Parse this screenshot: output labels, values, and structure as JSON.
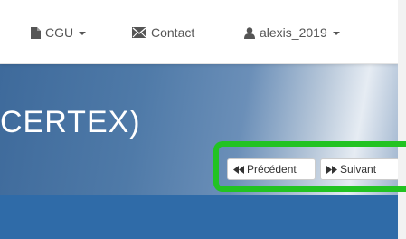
{
  "navbar": {
    "items": [
      {
        "label": "CGU",
        "icon": "file-icon",
        "dropdown": true
      },
      {
        "label": "Contact",
        "icon": "envelope-icon",
        "dropdown": false
      },
      {
        "label": "alexis_2019",
        "icon": "user-icon",
        "dropdown": true
      }
    ]
  },
  "banner": {
    "title": "CERTEX)"
  },
  "pagination": {
    "previous_label": "Précédent",
    "previous_icon": "fast-backward-icon",
    "next_label": "Suivant",
    "next_icon": "fast-forward-icon"
  },
  "colors": {
    "banner": "#4f7aa8",
    "subbar": "#2f6ba8",
    "highlight": "#22c322",
    "nav_text": "#555555"
  }
}
